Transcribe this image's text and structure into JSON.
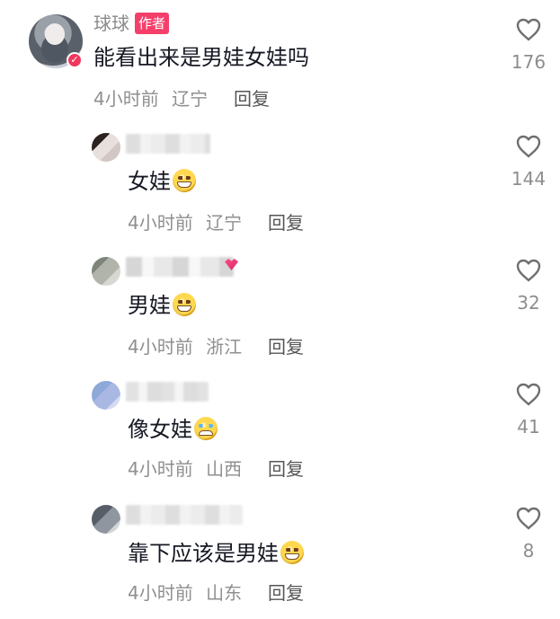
{
  "comments": [
    {
      "name": "球球",
      "author_tag": "作者",
      "text": "能看出来是男娃女娃吗",
      "time": "4小时前",
      "location": "辽宁",
      "reply": "回复",
      "likes": "176",
      "avatar_icon": "user-avatar-icon",
      "verified_icon": "verified-badge-icon"
    },
    {
      "text": "女娃",
      "emoji": "grinning-face",
      "time": "4小时前",
      "location": "辽宁",
      "reply": "回复",
      "likes": "144",
      "avatar_icon": "user-avatar-icon"
    },
    {
      "text": "男娃",
      "emoji": "grinning-face",
      "time": "4小时前",
      "location": "浙江",
      "reply": "回复",
      "likes": "32",
      "avatar_icon": "user-avatar-icon"
    },
    {
      "text": "像女娃",
      "emoji": "crying-laughing-face",
      "time": "4小时前",
      "location": "山西",
      "reply": "回复",
      "likes": "41",
      "avatar_icon": "user-avatar-icon"
    },
    {
      "text": "靠下应该是男娃",
      "emoji": "grinning-face",
      "time": "4小时前",
      "location": "山东",
      "reply": "回复",
      "likes": "8",
      "avatar_icon": "user-avatar-icon"
    }
  ],
  "icons": {
    "like": "heart-icon"
  },
  "colors": {
    "author_tag": "#f53f6a",
    "text": "#161823",
    "secondary_text": "#8f8f8f",
    "reply_text": "#555555"
  }
}
